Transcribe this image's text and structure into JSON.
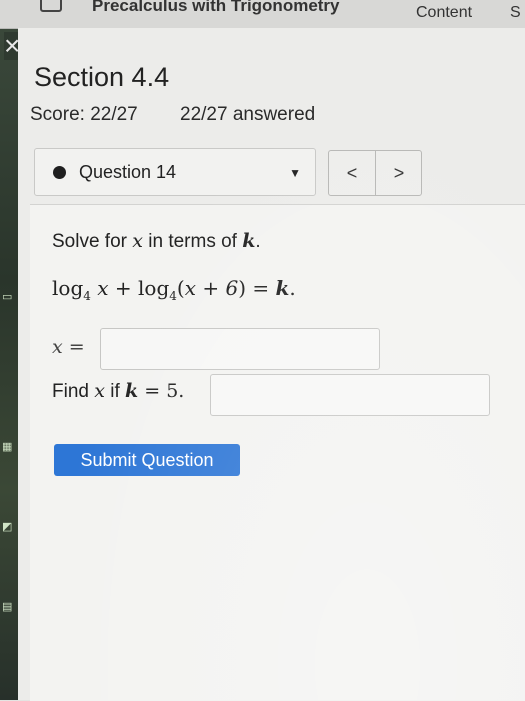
{
  "top_bar": {
    "course_title": "Precalculus with Trigonometry",
    "content_link": "Content",
    "more_link": "S"
  },
  "header": {
    "close_glyph": "×",
    "section_title": "Section 4.4",
    "score": "Score: 22/27",
    "answered": "22/27 answered"
  },
  "question_nav": {
    "selected": "Question 14",
    "prev_glyph": "<",
    "next_glyph": ">"
  },
  "question": {
    "prompt_prefix": "Solve for ",
    "prompt_var": "x",
    "prompt_mid": " in terms of ",
    "prompt_k": "k",
    "prompt_end": ".",
    "equation": {
      "log": "log",
      "base": "4",
      "x": "x",
      "plus": " + ",
      "paren_open": "(",
      "inner": "x + 6",
      "paren_close": ")",
      "equals": " = ",
      "k": "k",
      "end": "."
    },
    "x_label_var": "x",
    "x_label_eq": " =",
    "x_answer": "",
    "find_prefix": "Find ",
    "find_var": "x",
    "find_mid": " if ",
    "find_k": "k",
    "find_eq": " = 5.",
    "find_answer": ""
  },
  "submit_label": "Submit Question"
}
